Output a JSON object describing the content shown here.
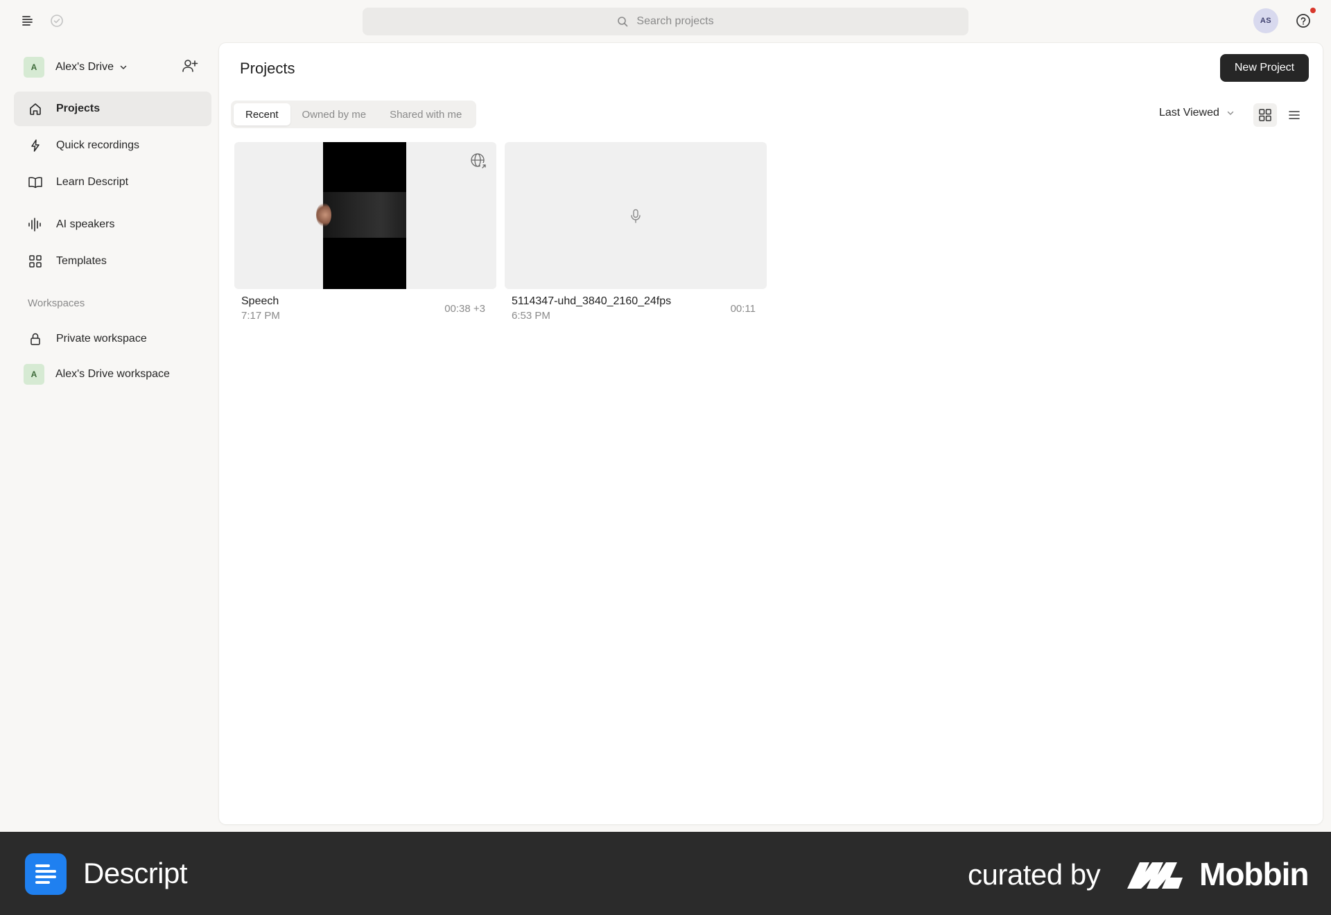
{
  "search": {
    "placeholder": "Search projects"
  },
  "user": {
    "initials": "AS"
  },
  "sidebar": {
    "drive": {
      "initial": "A",
      "name": "Alex's Drive"
    },
    "nav": [
      {
        "label": "Projects",
        "icon": "home-icon",
        "active": true
      },
      {
        "label": "Quick recordings",
        "icon": "lightning-icon"
      },
      {
        "label": "Learn Descript",
        "icon": "book-icon"
      },
      {
        "label": "AI speakers",
        "icon": "waveform-icon"
      },
      {
        "label": "Templates",
        "icon": "grid-icon"
      }
    ],
    "workspaces_title": "Workspaces",
    "workspaces": [
      {
        "label": "Private workspace",
        "icon": "lock-icon"
      },
      {
        "label": "Alex's Drive workspace",
        "initial": "A"
      }
    ]
  },
  "main": {
    "title": "Projects",
    "new_project_label": "New Project",
    "tabs": [
      {
        "label": "Recent",
        "active": true
      },
      {
        "label": "Owned by me"
      },
      {
        "label": "Shared with me"
      }
    ],
    "sort_label": "Last Viewed",
    "projects": [
      {
        "name": "Speech",
        "time": "7:17 PM",
        "duration": "00:38 +3",
        "thumb": "video"
      },
      {
        "name": "5114347-uhd_3840_2160_24fps",
        "time": "6:53 PM",
        "duration": "00:11",
        "thumb": "audio"
      }
    ]
  },
  "footer": {
    "brand": "Descript",
    "curated_by": "curated by",
    "mobbin": "Mobbin"
  },
  "colors": {
    "accent_dark": "#262626",
    "brand_blue": "#1f80f0",
    "notification": "#d8372b",
    "active_nav_bg": "#ebeae8"
  }
}
